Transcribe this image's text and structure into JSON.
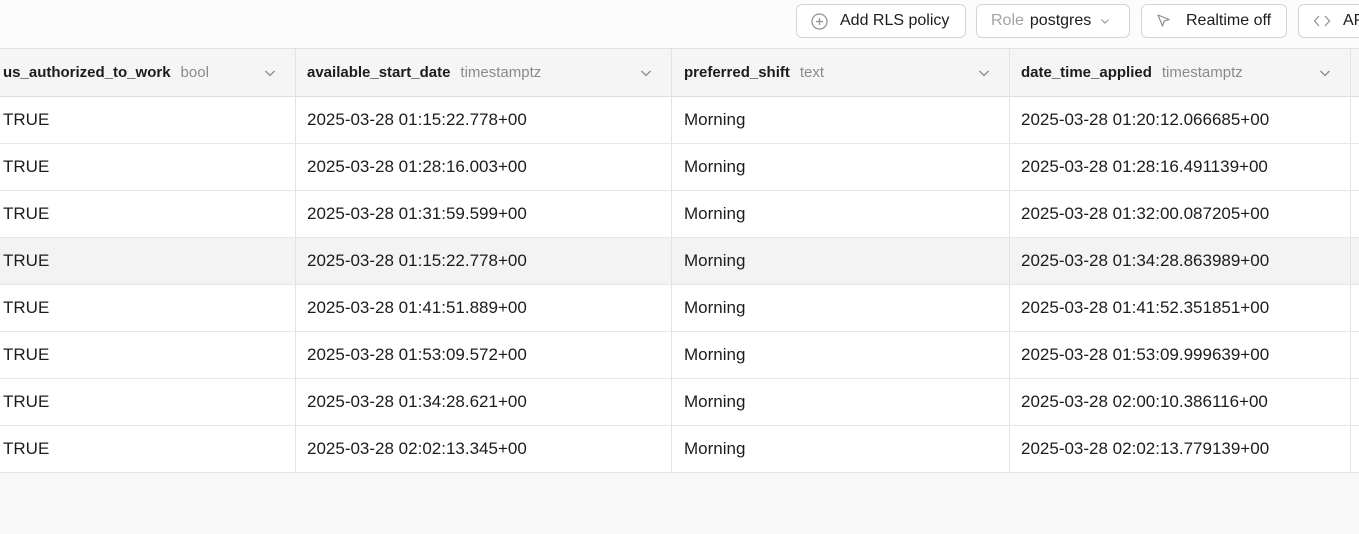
{
  "toolbar": {
    "add_rls_label": "Add RLS policy",
    "role_key": "Role",
    "role_value": "postgres",
    "realtime_label": "Realtime off",
    "api_label": "API"
  },
  "table": {
    "columns": [
      {
        "name": "us_authorized_to_work",
        "type": "bool"
      },
      {
        "name": "available_start_date",
        "type": "timestamptz"
      },
      {
        "name": "preferred_shift",
        "type": "text"
      },
      {
        "name": "date_time_applied",
        "type": "timestamptz"
      }
    ],
    "rows": [
      [
        "TRUE",
        "2025-03-28 01:15:22.778+00",
        "Morning",
        "2025-03-28 01:20:12.066685+00"
      ],
      [
        "TRUE",
        "2025-03-28 01:28:16.003+00",
        "Morning",
        "2025-03-28 01:28:16.491139+00"
      ],
      [
        "TRUE",
        "2025-03-28 01:31:59.599+00",
        "Morning",
        "2025-03-28 01:32:00.087205+00"
      ],
      [
        "TRUE",
        "2025-03-28 01:15:22.778+00",
        "Morning",
        "2025-03-28 01:34:28.863989+00"
      ],
      [
        "TRUE",
        "2025-03-28 01:41:51.889+00",
        "Morning",
        "2025-03-28 01:41:52.351851+00"
      ],
      [
        "TRUE",
        "2025-03-28 01:53:09.572+00",
        "Morning",
        "2025-03-28 01:53:09.999639+00"
      ],
      [
        "TRUE",
        "2025-03-28 01:34:28.621+00",
        "Morning",
        "2025-03-28 02:00:10.386116+00"
      ],
      [
        "TRUE",
        "2025-03-28 02:02:13.345+00",
        "Morning",
        "2025-03-28 02:02:13.779139+00"
      ]
    ],
    "highlighted_row": 3
  },
  "icons": {
    "add": "plus-circle-icon",
    "role_chevron": "chevron-down-icon",
    "realtime": "cursor-icon",
    "api": "code-icon",
    "column_menu": "chevron-down-icon"
  }
}
